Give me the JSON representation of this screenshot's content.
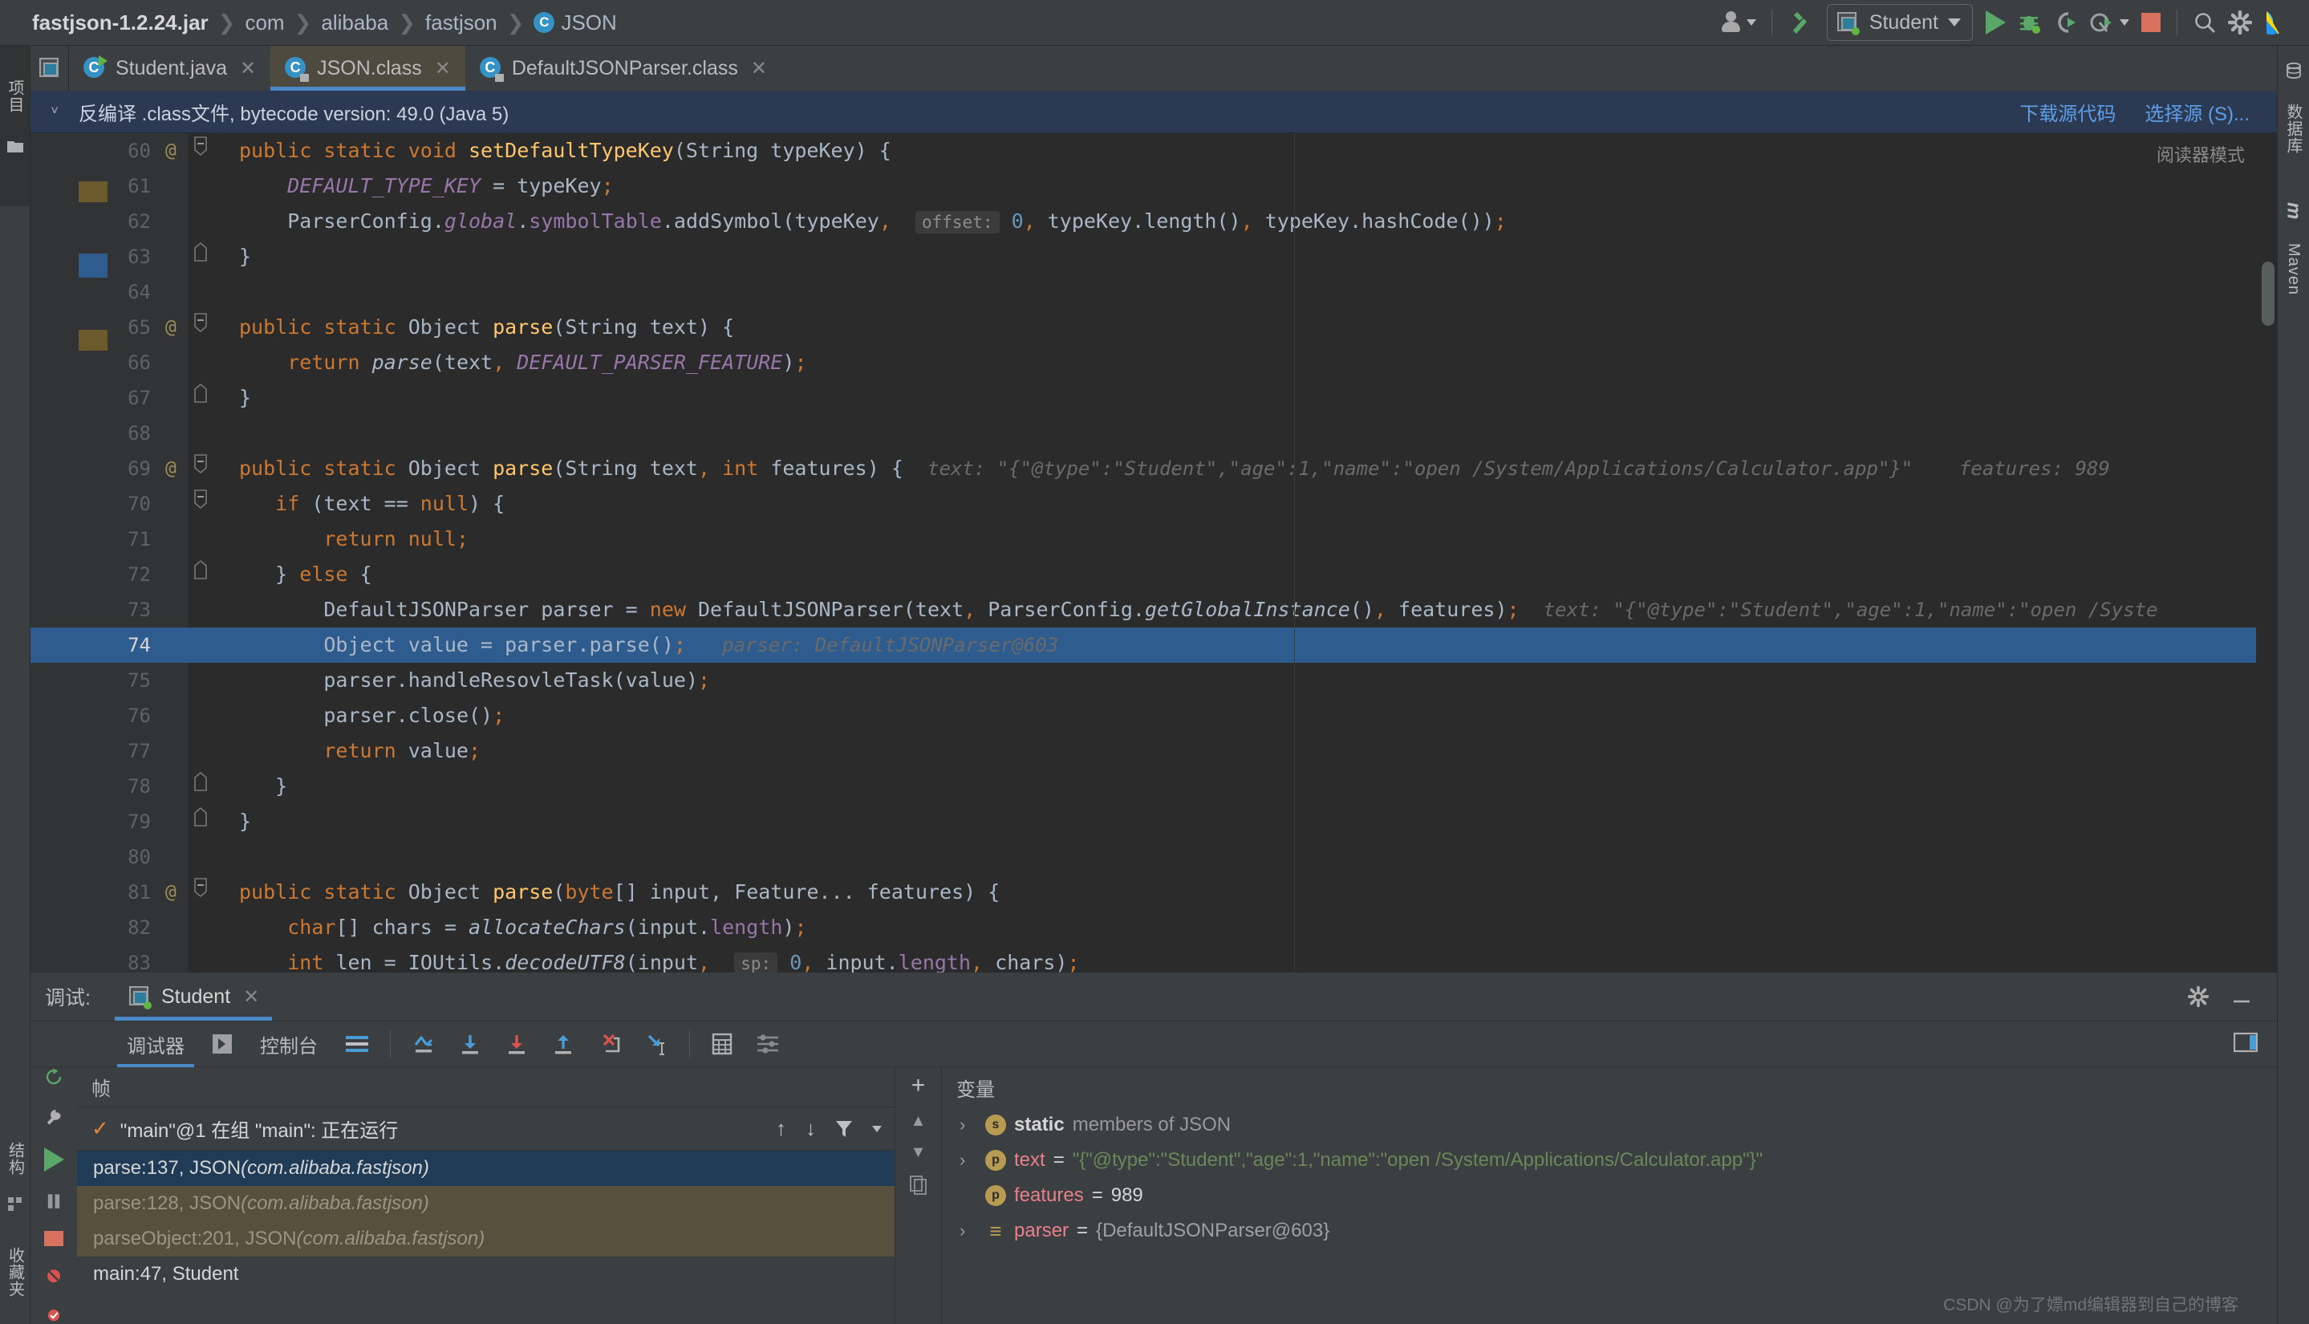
{
  "breadcrumb": {
    "items": [
      "fastjson-1.2.24.jar",
      "com",
      "alibaba",
      "fastjson",
      "JSON"
    ],
    "class_icon": "C"
  },
  "toolbar": {
    "vcs_icon": "person-icon",
    "build_icon": "hammer-icon",
    "run_config": "Student",
    "run_icon": "run-icon",
    "debug_icon": "debug-icon",
    "run_coverage_icon": "run-with-coverage-icon",
    "profile_icon": "profiler-icon",
    "stop_icon": "stop-icon",
    "search_icon": "search-icon",
    "settings_icon": "gear-icon",
    "ide_icon": "intellij-logo-icon"
  },
  "left_strip": {
    "project_label": "项目",
    "structure_label": "结构",
    "favorites_label": "收藏夹"
  },
  "right_strip": {
    "database_label": "数据库",
    "maven_label": "Maven"
  },
  "tabs": [
    {
      "label": "Student.java",
      "icon": "java-class-icon",
      "active": false
    },
    {
      "label": "JSON.class",
      "icon": "class-file-icon",
      "active": true
    },
    {
      "label": "DefaultJSONParser.class",
      "icon": "class-file-icon",
      "active": false
    }
  ],
  "notification": {
    "message": "反编译 .class文件, bytecode version: 49.0 (Java 5)",
    "links": [
      "下载源代码",
      "选择源 (S)..."
    ]
  },
  "editor": {
    "reader_mode": "阅读器模式",
    "highlighted_line": 74,
    "lines": [
      {
        "n": 60,
        "gutter": "@",
        "fold": "minus",
        "html": "<span class=\"kw\">public static void </span><span class=\"fn\">setDefaultTypeKey</span><span class=\"pnc\">(</span><span class=\"id\">String typeKey</span><span class=\"pnc\">) {</span>",
        "indent": 0
      },
      {
        "n": 61,
        "gutter": "",
        "fold": "",
        "html": "    <span class=\"fldi\">DEFAULT_TYPE_KEY </span><span class=\"pnc\">= </span><span class=\"id\">typeKey</span><span class=\"sem\">;</span>"
      },
      {
        "n": 62,
        "gutter": "",
        "fold": "",
        "html": "    <span class=\"id\">ParserConfig</span><span class=\"pnc\">.</span><span class=\"fldi\">global</span><span class=\"pnc\">.</span><span class=\"fld\">symbolTable</span><span class=\"pnc\">.</span><span class=\"id\">addSymbol</span><span class=\"pnc\">(</span><span class=\"id\">typeKey</span><span class=\"sem\">,</span>  <span class=\"hintbox\">offset:</span> <span class=\"num\">0</span><span class=\"sem\">,</span> <span class=\"id\">typeKey</span><span class=\"pnc\">.</span><span class=\"id\">length</span><span class=\"pnc\">()</span><span class=\"sem\">,</span> <span class=\"id\">typeKey</span><span class=\"pnc\">.</span><span class=\"id\">hashCode</span><span class=\"pnc\">())</span><span class=\"sem\">;</span>"
      },
      {
        "n": 63,
        "gutter": "",
        "fold": "close",
        "html": "<span class=\"pnc\">}</span>"
      },
      {
        "n": 64,
        "gutter": "",
        "fold": "",
        "html": ""
      },
      {
        "n": 65,
        "gutter": "@",
        "fold": "minus",
        "html": "<span class=\"kw\">public static </span><span class=\"id\">Object </span><span class=\"fn\">parse</span><span class=\"pnc\">(</span><span class=\"id\">String text</span><span class=\"pnc\">) {</span>"
      },
      {
        "n": 66,
        "gutter": "",
        "fold": "",
        "html": "    <span class=\"kw\">return </span><span class=\"sta\">parse</span><span class=\"pnc\">(</span><span class=\"id\">text</span><span class=\"sem\">, </span><span class=\"fldi\">DEFAULT_PARSER_FEATURE</span><span class=\"pnc\">)</span><span class=\"sem\">;</span>"
      },
      {
        "n": 67,
        "gutter": "",
        "fold": "close",
        "html": "<span class=\"pnc\">}</span>"
      },
      {
        "n": 68,
        "gutter": "",
        "fold": "",
        "html": ""
      },
      {
        "n": 69,
        "gutter": "@",
        "fold": "minus",
        "html": "<span class=\"kw\">public static </span><span class=\"id\">Object </span><span class=\"fn\">parse</span><span class=\"pnc\">(</span><span class=\"id\">String text</span><span class=\"sem\">, </span><span class=\"kw\">int </span><span class=\"id\">features</span><span class=\"pnc\">) {</span>  <span class=\"inlay\">text: \"{\"@type\":\"Student\",\"age\":1,\"name\":\"open /System/Applications/Calculator.app\"}\"    features: 989</span>"
      },
      {
        "n": 70,
        "gutter": "",
        "fold": "minus",
        "html": "   <span class=\"kw\">if </span><span class=\"pnc\">(</span><span class=\"id\">text </span><span class=\"pnc\">== </span><span class=\"kw\">null</span><span class=\"pnc\">) {</span>"
      },
      {
        "n": 71,
        "gutter": "",
        "fold": "",
        "html": "       <span class=\"kw\">return null</span><span class=\"sem\">;</span>"
      },
      {
        "n": 72,
        "gutter": "",
        "fold": "close",
        "html": "   <span class=\"pnc\">} </span><span class=\"kw\">else </span><span class=\"pnc\">{</span>"
      },
      {
        "n": 73,
        "gutter": "",
        "fold": "",
        "html": "       <span class=\"id\">DefaultJSONParser parser </span><span class=\"pnc\">= </span><span class=\"kw\">new </span><span class=\"id\">DefaultJSONParser</span><span class=\"pnc\">(</span><span class=\"id\">text</span><span class=\"sem\">, </span><span class=\"id\">ParserConfig</span><span class=\"pnc\">.</span><span class=\"sta\">getGlobalInstance</span><span class=\"pnc\">()</span><span class=\"sem\">, </span><span class=\"id\">features</span><span class=\"pnc\">)</span><span class=\"sem\">;</span>  <span class=\"inlay\">text: \"{\"@type\":\"Student\",\"age\":1,\"name\":\"open /Syste</span>"
      },
      {
        "n": 74,
        "gutter": "",
        "fold": "",
        "html": "       <span class=\"id\">Object value </span><span class=\"pnc\">= </span><span class=\"id\">parser</span><span class=\"pnc\">.</span><span class=\"id\">parse</span><span class=\"pnc\">()</span><span class=\"sem\">;</span>   <span class=\"inlay\">parser: DefaultJSONParser@603</span>"
      },
      {
        "n": 75,
        "gutter": "",
        "fold": "",
        "html": "       <span class=\"id\">parser</span><span class=\"pnc\">.</span><span class=\"id\">handleResovleTask</span><span class=\"pnc\">(</span><span class=\"id\">value</span><span class=\"pnc\">)</span><span class=\"sem\">;</span>"
      },
      {
        "n": 76,
        "gutter": "",
        "fold": "",
        "html": "       <span class=\"id\">parser</span><span class=\"pnc\">.</span><span class=\"id\">close</span><span class=\"pnc\">()</span><span class=\"sem\">;</span>"
      },
      {
        "n": 77,
        "gutter": "",
        "fold": "",
        "html": "       <span class=\"kw\">return </span><span class=\"id\">value</span><span class=\"sem\">;</span>"
      },
      {
        "n": 78,
        "gutter": "",
        "fold": "close",
        "html": "   <span class=\"pnc\">}</span>"
      },
      {
        "n": 79,
        "gutter": "",
        "fold": "close",
        "html": "<span class=\"pnc\">}</span>"
      },
      {
        "n": 80,
        "gutter": "",
        "fold": "",
        "html": ""
      },
      {
        "n": 81,
        "gutter": "@",
        "fold": "minus",
        "html": "<span class=\"kw\">public static </span><span class=\"id\">Object </span><span class=\"fn\">parse</span><span class=\"pnc\">(</span><span class=\"kw\">byte</span><span class=\"pnc\">[] </span><span class=\"id\">input</span><span class=\"pnc\">, </span><span class=\"id\">Feature</span><span class=\"pnc\">... </span><span class=\"id\">features</span><span class=\"pnc\">) {</span>"
      },
      {
        "n": 82,
        "gutter": "",
        "fold": "",
        "html": "    <span class=\"kw\">char</span><span class=\"pnc\">[] </span><span class=\"id\">chars </span><span class=\"pnc\">= </span><span class=\"sta\">allocateChars</span><span class=\"pnc\">(</span><span class=\"id\">input</span><span class=\"pnc\">.</span><span class=\"fld\">length</span><span class=\"pnc\">)</span><span class=\"sem\">;</span>"
      },
      {
        "n": 83,
        "gutter": "",
        "fold": "",
        "html": "    <span class=\"kw\">int </span><span class=\"id\">len </span><span class=\"pnc\">= </span><span class=\"id\">IOUtils</span><span class=\"pnc\">.</span><span class=\"sta\">decodeUTF8</span><span class=\"pnc\">(</span><span class=\"id\">input</span><span class=\"sem\">,</span>  <span class=\"hintbox\">sp:</span> <span class=\"num\">0</span><span class=\"sem\">,</span> <span class=\"id\">input</span><span class=\"pnc\">.</span><span class=\"fld\">length</span><span class=\"sem\">,</span> <span class=\"id\">chars</span><span class=\"pnc\">)</span><span class=\"sem\">;</span>"
      }
    ]
  },
  "debug": {
    "title": "调试:",
    "session_tab": "Student",
    "tabs": [
      "调试器",
      "控制台"
    ],
    "frames_header": "帧",
    "vars_header": "变量",
    "thread": "\"main\"@1 在组 \"main\": 正在运行",
    "frames": [
      {
        "text": "parse:137, JSON",
        "pkg": "(com.alibaba.fastjson)",
        "state": "sel"
      },
      {
        "text": "parse:128, JSON",
        "pkg": "(com.alibaba.fastjson)",
        "state": "lib"
      },
      {
        "text": "parseObject:201, JSON",
        "pkg": "(com.alibaba.fastjson)",
        "state": "lib"
      },
      {
        "text": "main:47, Student",
        "pkg": "",
        "state": "plain"
      }
    ],
    "variables": [
      {
        "twisty": "›",
        "badge": "s",
        "badge_kind": "static",
        "name": "static",
        "suffix": " members of JSON",
        "eq": "",
        "value": "",
        "value_kind": "none"
      },
      {
        "twisty": "›",
        "badge": "p",
        "badge_kind": "field",
        "name": "text",
        "suffix": "",
        "eq": " = ",
        "value": "\"{\"@type\":\"Student\",\"age\":1,\"name\":\"open /System/Applications/Calculator.app\"}\"",
        "value_kind": "string"
      },
      {
        "twisty": "",
        "badge": "p",
        "badge_kind": "field",
        "name": "features",
        "suffix": "",
        "eq": " = ",
        "value": "989",
        "value_kind": "number"
      },
      {
        "twisty": "›",
        "badge": "≡",
        "badge_kind": "list",
        "name": "parser",
        "suffix": "",
        "eq": " = ",
        "value": "{DefaultJSONParser@603}",
        "value_kind": "object"
      }
    ],
    "settings_icon": "gear-icon",
    "minimize_icon": "minimize-icon",
    "layout_icon": "layout-icon"
  },
  "watermark": "CSDN @为了嫖md编辑器到自己的博客",
  "colors": {
    "accent_blue": "#4a88c7",
    "selection_blue": "#2f5c8f",
    "tab_active": "#4e4a3f",
    "notification_bg": "#2b3a52",
    "run_green": "#59a869",
    "stop_red": "#d9715f",
    "string_green": "#6a8759",
    "keyword_orange": "#cc7832",
    "method_yellow": "#ffc66d",
    "field_purple": "#9876aa",
    "number_blue": "#6897bb"
  }
}
